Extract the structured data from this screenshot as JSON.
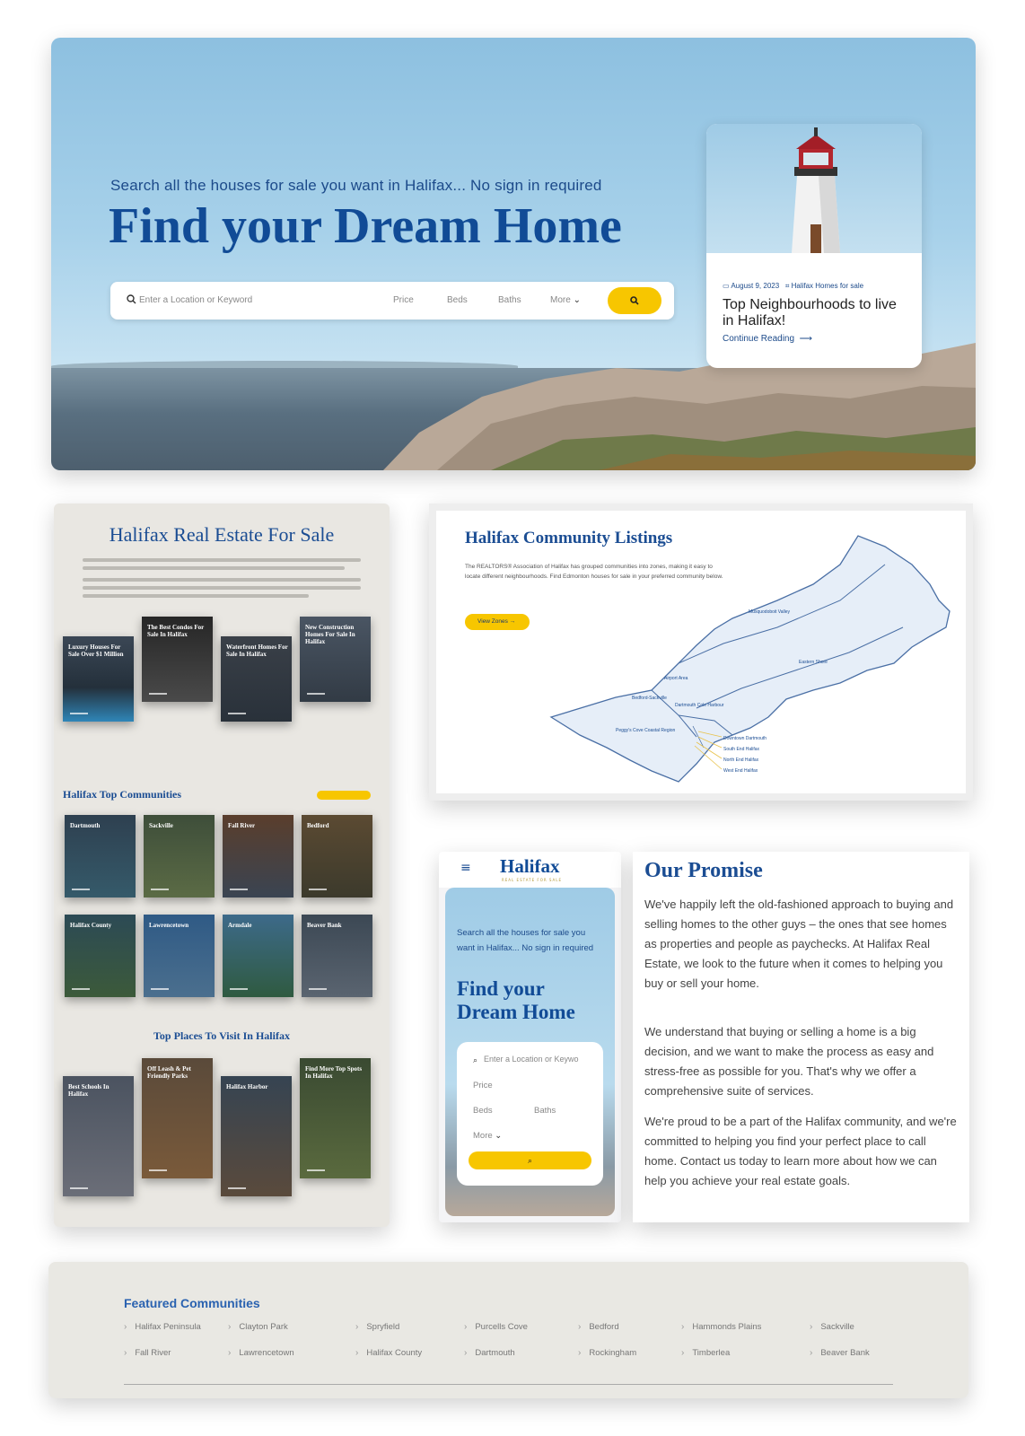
{
  "hero": {
    "tagline": "Search all the houses for sale you want in Halifax... No sign in required",
    "title": "Find your Dream Home",
    "search": {
      "placeholder": "Enter a Location or Keyword",
      "price": "Price",
      "beds": "Beds",
      "baths": "Baths",
      "more": "More"
    },
    "blog": {
      "date": "August 9, 2023",
      "category": "Halifax Homes for sale",
      "title": "Top Neighbourhoods to live in Halifax!",
      "cta": "Continue Reading"
    }
  },
  "real_estate": {
    "title": "Halifax Real Estate For Sale",
    "listings": [
      "Luxury Houses For Sale Over $1 Million",
      "The Best Condos For Sale In Halifax",
      "Waterfront Homes For Sale In Halifax",
      "New Construction Homes For Sale In Halifax"
    ],
    "communities_title": "Halifax Top Communities",
    "communities": [
      "Dartmouth",
      "Sackville",
      "Fall River",
      "Bedford",
      "Halifax County",
      "Lawrencetown",
      "Armdale",
      "Beaver Bank"
    ],
    "places_title": "Top Places To Visit In Halifax",
    "places": [
      "Best Schools In Halifax",
      "Off Leash & Pet Friendly Parks",
      "Halifax Harbor",
      "Find More Top Spots In Halifax"
    ]
  },
  "community_listings": {
    "title": "Halifax Community Listings",
    "description": "The REALTORS® Association of Halifax has grouped communities into zones, making it easy to locate different neighbourhoods. Find Edmonton houses for sale in your preferred community below.",
    "button": "View Zones",
    "map_labels": [
      "Musquodoboit Valley",
      "Eastern Shore",
      "Airport Area",
      "Bedford-Sackville",
      "Dartmouth Cole Harbour",
      "Peggy's Cove Coastal Region",
      "Downtown Dartmouth",
      "South End Halifax",
      "North End Halifax",
      "West End Halifax"
    ]
  },
  "mobile": {
    "logo": "Halifax",
    "logo_sub": "REAL ESTATE FOR SALE",
    "tagline": "Search all the houses for sale you want in Halifax... No sign in required",
    "title": "Find your Dream Home",
    "placeholder": "Enter a Location or Keywo",
    "price": "Price",
    "beds": "Beds",
    "baths": "Baths",
    "more": "More"
  },
  "promise": {
    "title": "Our Promise",
    "p1": "We've happily left the old-fashioned approach to buying and selling homes to the other guys – the ones that see homes as properties and people as paychecks. At Halifax Real Estate, we look to the future when it comes to helping you buy or sell your home.",
    "p2": "We understand that buying or selling a home is a big decision, and we want to make the process as easy and stress-free as possible for you. That's why we offer a comprehensive suite of services.",
    "p3": "We're proud to be a part of the Halifax community, and we're committed to helping you find your perfect place to call home. Contact us today to learn more about how we can help you achieve your real estate goals."
  },
  "featured": {
    "title": "Featured Communities",
    "row1": [
      "Halifax Peninsula",
      "Clayton Park",
      "Spryfield",
      "Purcells Cove",
      "Bedford",
      "Hammonds Plains",
      "Sackville"
    ],
    "row2": [
      "Fall River",
      "Lawrencetown",
      "Halifax County",
      "Dartmouth",
      "Rockingham",
      "Timberlea",
      "Beaver Bank"
    ]
  },
  "colors": {
    "brand_blue": "#114b96",
    "accent_yellow": "#f7c600"
  }
}
